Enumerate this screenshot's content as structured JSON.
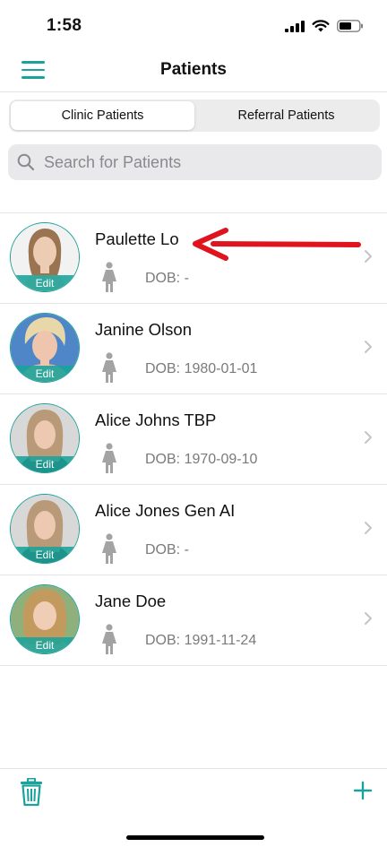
{
  "status": {
    "time": "1:58"
  },
  "header": {
    "title": "Patients",
    "menu_icon": "hamburger-menu-icon"
  },
  "tabs": [
    {
      "label": "Clinic Patients",
      "active": true
    },
    {
      "label": "Referral Patients",
      "active": false
    }
  ],
  "search": {
    "placeholder": "Search for Patients",
    "value": ""
  },
  "patients": [
    {
      "name": "Paulette Lo",
      "dob": "DOB: -",
      "edit": "Edit",
      "gender_icon": "female-icon"
    },
    {
      "name": "Janine Olson",
      "dob": "DOB: 1980-01-01",
      "edit": "Edit",
      "gender_icon": "female-icon"
    },
    {
      "name": "Alice Johns TBP",
      "dob": "DOB: 1970-09-10",
      "edit": "Edit",
      "gender_icon": "female-icon"
    },
    {
      "name": "Alice Jones Gen AI",
      "dob": "DOB: -",
      "edit": "Edit",
      "gender_icon": "female-icon"
    },
    {
      "name": "Jane Doe",
      "dob": "DOB: 1991-11-24",
      "edit": "Edit",
      "gender_icon": "female-icon"
    }
  ],
  "toolbar": {
    "delete_icon": "trash-icon",
    "add_icon": "plus-icon"
  },
  "colors": {
    "accent": "#1aa39a",
    "arrow": "#e0141e",
    "secondary_text": "#7a7a7a"
  }
}
